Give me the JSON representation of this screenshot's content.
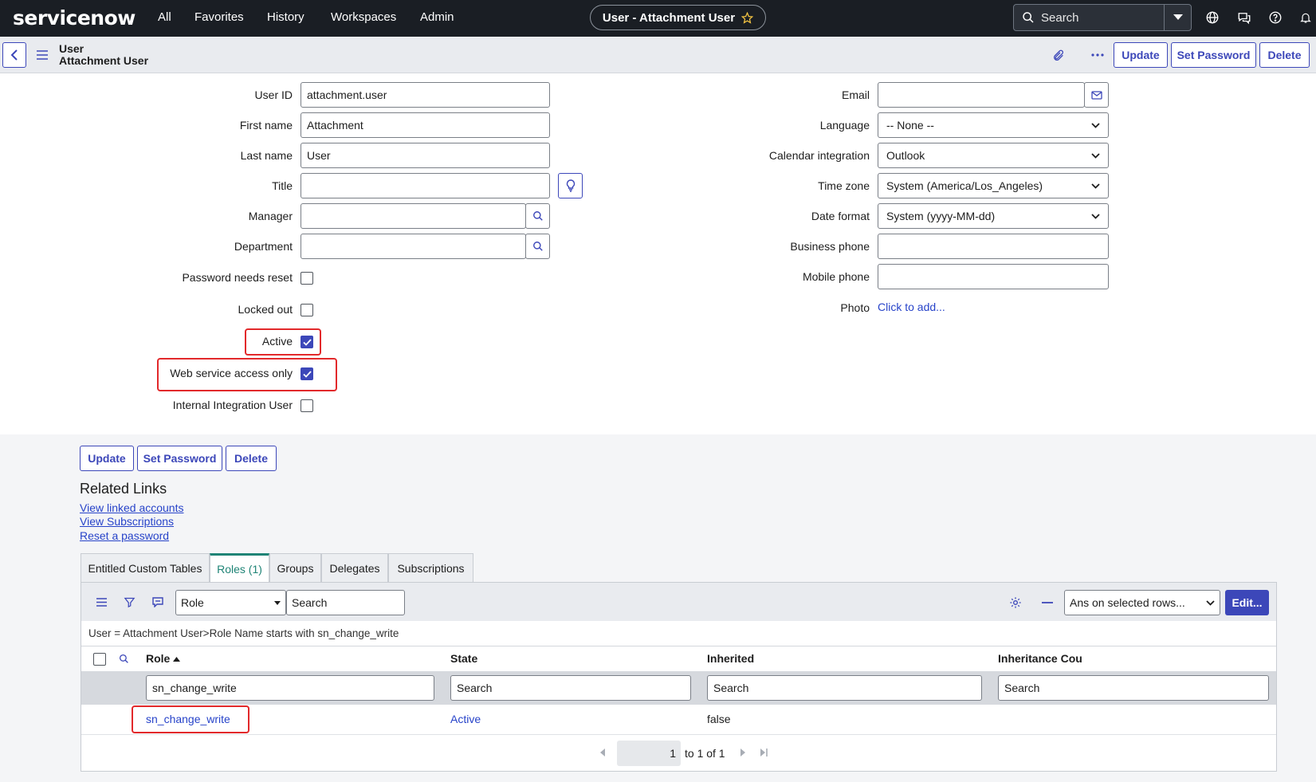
{
  "topnav": {
    "logo": "servicenow",
    "links": [
      "All",
      "Favorites",
      "History",
      "Workspaces",
      "Admin"
    ],
    "record_title": "User - Attachment User",
    "search_placeholder": "Search"
  },
  "form_header": {
    "table": "User",
    "record": "Attachment User",
    "buttons": {
      "update": "Update",
      "set_password": "Set Password",
      "delete": "Delete"
    }
  },
  "left_fields": {
    "user_id": {
      "label": "User ID",
      "value": "attachment.user"
    },
    "first_name": {
      "label": "First name",
      "value": "Attachment"
    },
    "last_name": {
      "label": "Last name",
      "value": "User"
    },
    "title": {
      "label": "Title",
      "value": ""
    },
    "manager": {
      "label": "Manager",
      "value": ""
    },
    "department": {
      "label": "Department",
      "value": ""
    },
    "password_needs_reset": {
      "label": "Password needs reset",
      "checked": false
    },
    "locked_out": {
      "label": "Locked out",
      "checked": false
    },
    "active": {
      "label": "Active",
      "checked": true
    },
    "web_service_access_only": {
      "label": "Web service access only",
      "checked": true
    },
    "internal_integration_user": {
      "label": "Internal Integration User",
      "checked": false
    }
  },
  "right_fields": {
    "email": {
      "label": "Email",
      "value": ""
    },
    "language": {
      "label": "Language",
      "value": "-- None --"
    },
    "calendar_integration": {
      "label": "Calendar integration",
      "value": "Outlook"
    },
    "time_zone": {
      "label": "Time zone",
      "value": "System (America/Los_Angeles)"
    },
    "date_format": {
      "label": "Date format",
      "value": "System (yyyy-MM-dd)"
    },
    "business_phone": {
      "label": "Business phone",
      "value": ""
    },
    "mobile_phone": {
      "label": "Mobile phone",
      "value": ""
    },
    "photo": {
      "label": "Photo",
      "link": "Click to add..."
    }
  },
  "bottom_buttons": {
    "update": "Update",
    "set_password": "Set Password",
    "delete": "Delete"
  },
  "related_links": {
    "heading": "Related Links",
    "links": [
      "View linked accounts",
      "View Subscriptions",
      "Reset a password"
    ]
  },
  "tabs": [
    "Entitled Custom Tables",
    "Roles (1)",
    "Groups",
    "Delegates",
    "Subscriptions"
  ],
  "active_tab": "Roles (1)",
  "list": {
    "search_field": "Role",
    "search_placeholder": "Search",
    "actions_select": "Ans on selected rows...",
    "edit_button": "Edit...",
    "breadcrumb": "User = Attachment User>Role Name starts with sn_change_write",
    "columns": [
      "Role",
      "State",
      "Inherited",
      "Inheritance Cou"
    ],
    "filters": [
      "sn_change_write",
      "Search",
      "Search",
      "Search"
    ],
    "rows": [
      {
        "role": "sn_change_write",
        "state": "Active",
        "inherited": "false",
        "inheritance_count": ""
      }
    ],
    "pagination": {
      "page": "1",
      "range": "to 1 of 1"
    }
  },
  "colors": {
    "nav_bg": "#1a1e24",
    "primary": "#3c47b9",
    "link": "#2743c9",
    "highlight": "#e2292b",
    "active_tab": "#1f8476"
  }
}
